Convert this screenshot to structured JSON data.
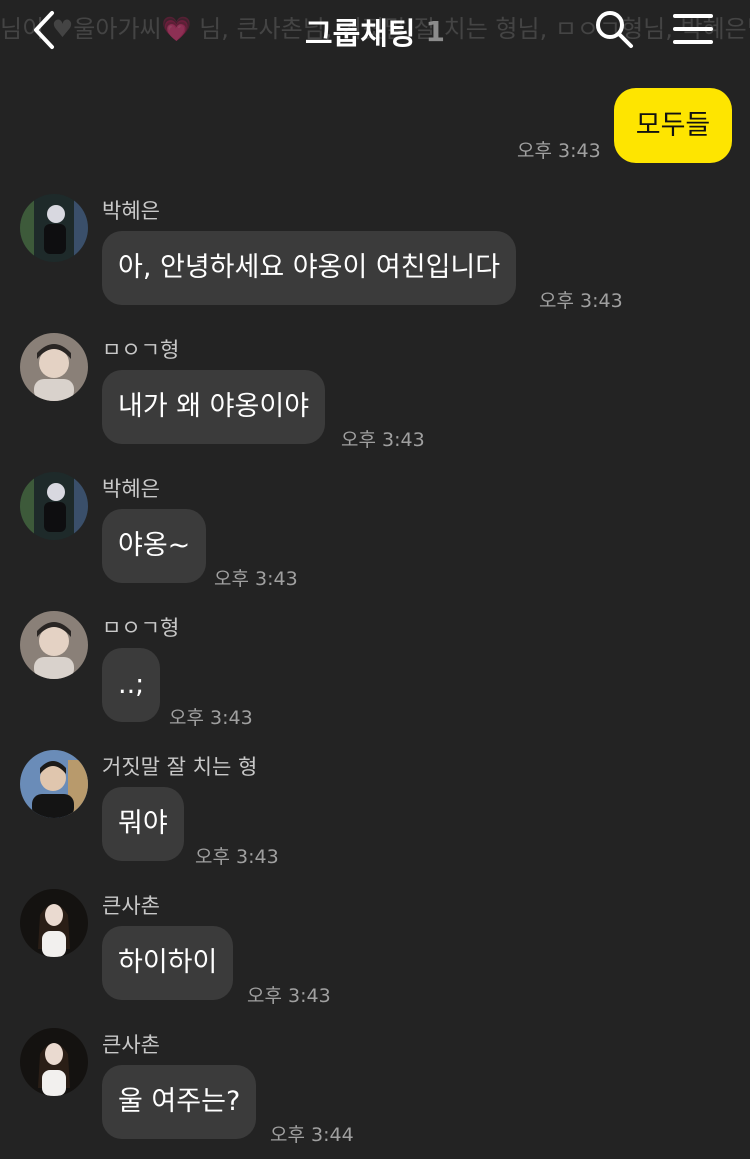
{
  "header": {
    "title": "그룹채팅",
    "member_count": "1",
    "participants": "님이 ♥울아가씨💗 님, 큰사촌님, 거짓말 잘 치는 형님, ㅁㅇㄱ형님, 박혜은님을 초대"
  },
  "icons": {
    "back": "chevron-left-icon",
    "search": "search-icon",
    "menu": "hamburger-menu-icon"
  },
  "colors": {
    "background": "#232323",
    "my_bubble": "#fee500",
    "other_bubble": "#3b3b3b"
  },
  "my_message": {
    "text": "모두들",
    "time": "오후 3:43"
  },
  "messages": [
    {
      "sender": "박혜은",
      "text": "아, 안녕하세요 야옹이 여친입니다",
      "time": "오후 3:43"
    },
    {
      "sender": "ㅁㅇㄱ형",
      "text": "내가 왜 야옹이야",
      "time": "오후 3:43"
    },
    {
      "sender": "박혜은",
      "text": "야옹~",
      "time": "오후 3:43"
    },
    {
      "sender": "ㅁㅇㄱ형",
      "text": "..;",
      "time": "오후 3:43"
    },
    {
      "sender": "거짓말 잘 치는 형",
      "text": "뭐야",
      "time": "오후 3:43"
    },
    {
      "sender": "큰사촌",
      "text": "하이하이",
      "time": "오후 3:43"
    },
    {
      "sender": "큰사촌",
      "text": "울 여주는?",
      "time": "오후 3:44"
    }
  ]
}
